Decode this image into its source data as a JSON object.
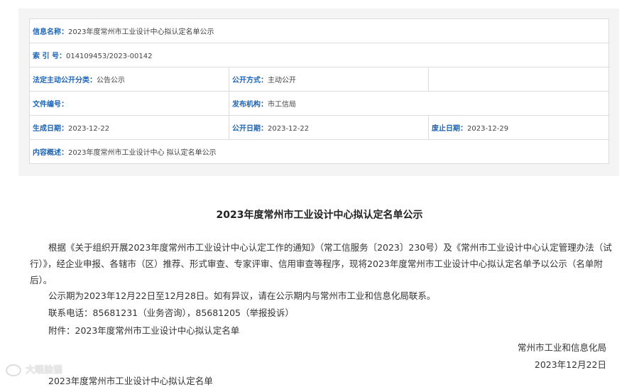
{
  "info": {
    "name_label": "信息名称：",
    "name_value": "2023年度常州市工业设计中心拟认定名单公示",
    "index_label": "索  引  号：",
    "index_value": "014109453/2023-00142",
    "category_label": "法定主动公开分类：",
    "category_value": "公告公示",
    "method_label": "公开方式：",
    "method_value": "主动公开",
    "docno_label": "文件编号：",
    "docno_value": "",
    "publisher_label": "发布机构：",
    "publisher_value": "市工信局",
    "created_label": "生成日期：",
    "created_value": "2023-12-22",
    "opened_label": "公开日期：",
    "opened_value": "2023-12-22",
    "deadline_label": "废止日期：",
    "deadline_value": "2023-12-29",
    "summary_label": "内容概述：",
    "summary_value": "2023年度常州市工业设计中心 拟认定名单公示"
  },
  "article": {
    "title": "2023年度常州市工业设计中心拟认定名单公示",
    "para1": "根据《关于组织开展2023年度常州市工业设计中心认定工作的通知》（常工信服务〔2023〕230号）及《常州市工业设计中心认定管理办法（试行）》，经企业申报、各辖市（区）推荐、形式审查、专家评审、信用审查等程序，现将2023年度常州市工业设计中心拟认定名单予以公示（名单附后）。",
    "para2": "公示期为2023年12月22日至12月28日。如有异议，请在公示期内与常州市工业和信息化局联系。",
    "para3": "联系电话：85681231（业务咨询），85681205（举报投诉）",
    "para4": "附件：2023年度常州市工业设计中心拟认定名单",
    "signer": "常州市工业和信息化局",
    "date": "2023年12月22日",
    "next_heading": "2023年度常州市工业设计中心拟认定名单"
  },
  "watermark": "大眼脸猫"
}
